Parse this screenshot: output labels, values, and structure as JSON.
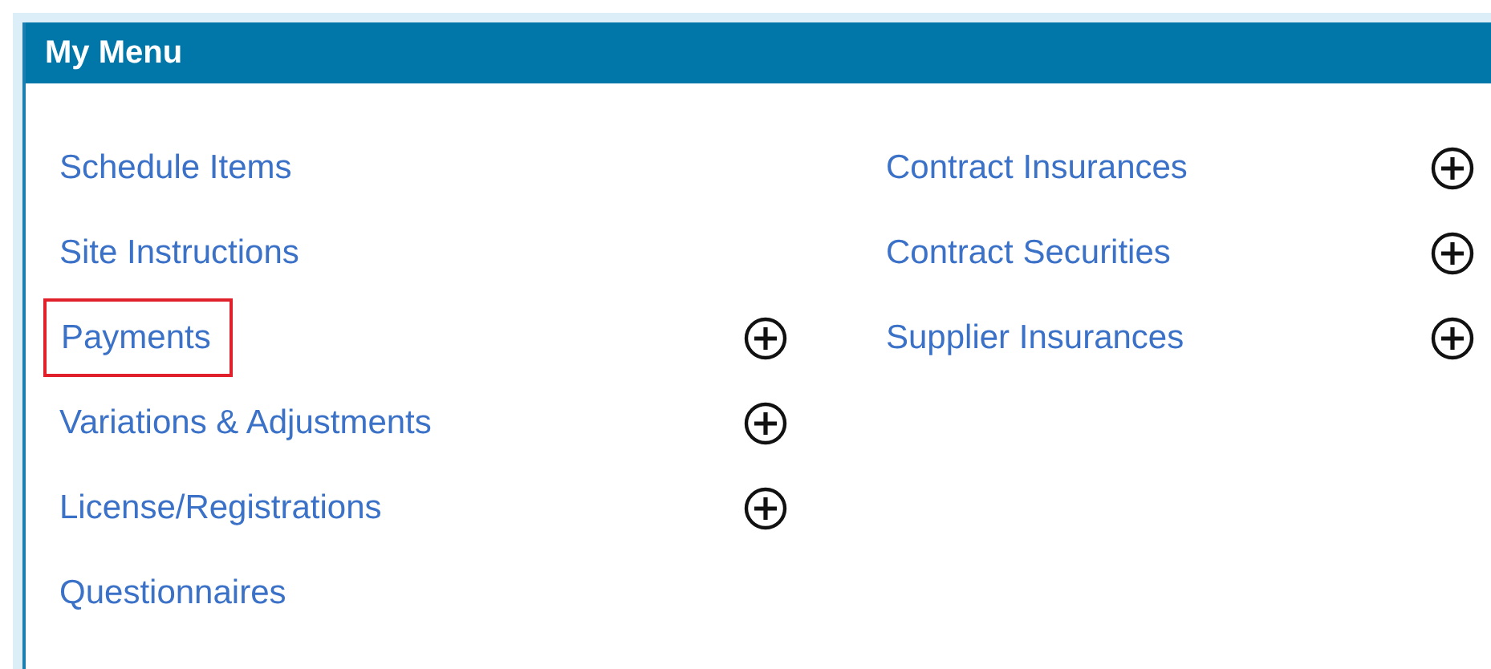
{
  "panel": {
    "title": "My Menu",
    "columns": [
      {
        "items": [
          {
            "label": "Schedule Items",
            "expandable": false,
            "highlighted": false
          },
          {
            "label": "Site Instructions",
            "expandable": false,
            "highlighted": false
          },
          {
            "label": "Payments",
            "expandable": true,
            "highlighted": true
          },
          {
            "label": "Variations & Adjustments",
            "expandable": true,
            "highlighted": false
          },
          {
            "label": "License/Registrations",
            "expandable": true,
            "highlighted": false
          },
          {
            "label": "Questionnaires",
            "expandable": false,
            "highlighted": false
          }
        ]
      },
      {
        "items": [
          {
            "label": "Contract Insurances",
            "expandable": true,
            "highlighted": false
          },
          {
            "label": "Contract Securities",
            "expandable": true,
            "highlighted": false
          },
          {
            "label": "Supplier Insurances",
            "expandable": true,
            "highlighted": false
          }
        ]
      }
    ]
  }
}
